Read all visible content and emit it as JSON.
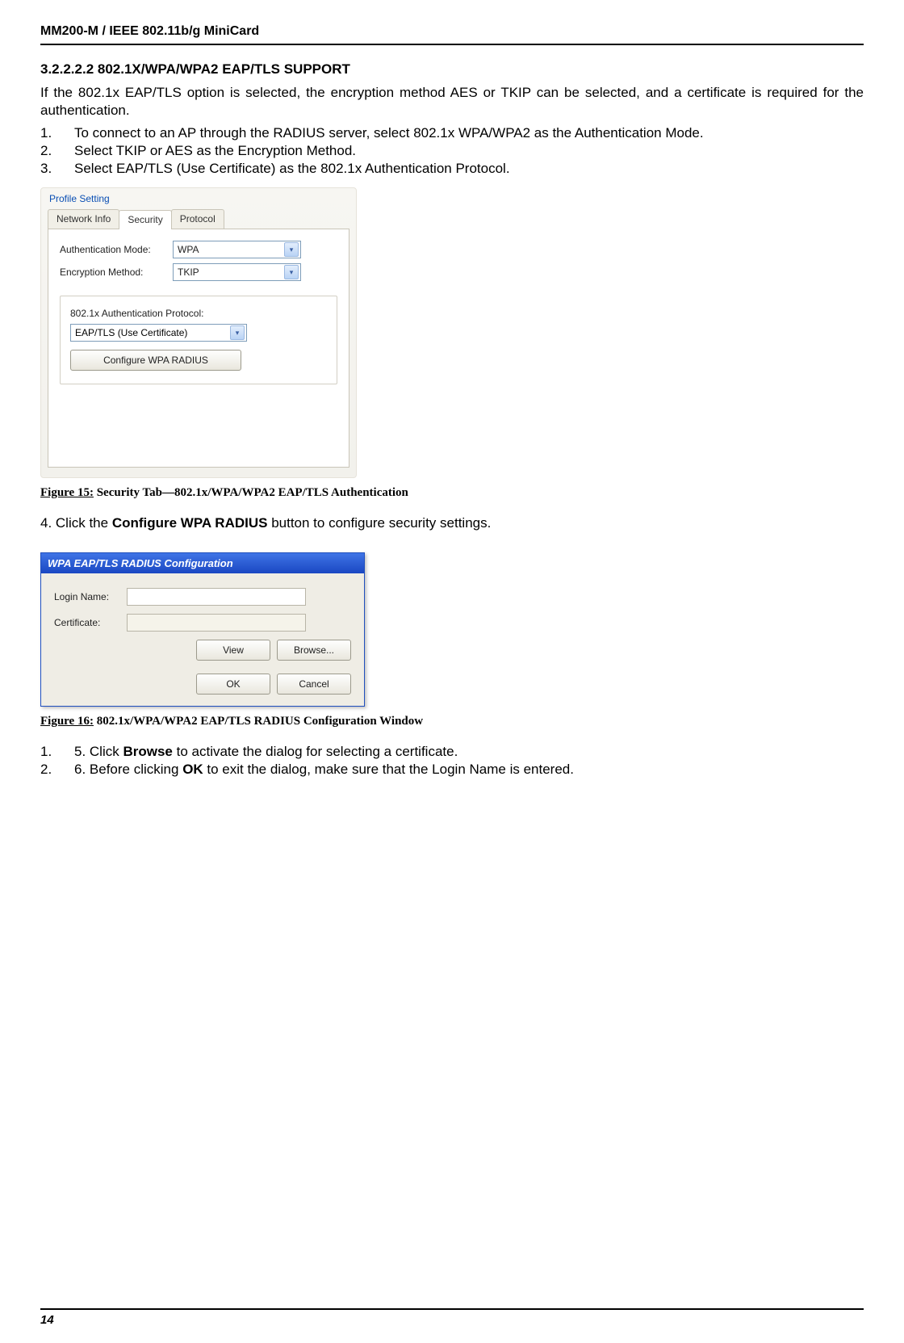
{
  "header": {
    "product": "MM200-M / IEEE 802.11b/g MiniCard"
  },
  "section": {
    "heading": "3.2.2.2.2 802.1X/WPA/WPA2 EAP/TLS SUPPORT"
  },
  "intro": "If the 802.1x EAP/TLS option is selected, the encryption method AES or TKIP can be selected, and a certificate is required for the authentication.",
  "steps1": [
    "To connect to an AP through the RADIUS server, select 802.1x WPA/WPA2 as the Authentication Mode.",
    "Select TKIP or AES as the Encryption Method.",
    "Select EAP/TLS (Use Certificate) as the 802.1x Authentication Protocol."
  ],
  "profile_panel": {
    "title": "Profile Setting",
    "tabs": [
      "Network Info",
      "Security",
      "Protocol"
    ],
    "active_tab_index": 1,
    "auth_mode_label": "Authentication Mode:",
    "auth_mode_value": "WPA",
    "enc_method_label": "Encryption Method:",
    "enc_method_value": "TKIP",
    "group_label": "802.1x Authentication Protocol:",
    "protocol_value": "EAP/TLS (Use Certificate)",
    "configure_btn": "Configure WPA RADIUS"
  },
  "figure15": {
    "label": "Figure 15:",
    "caption": " Security Tab—802.1x/WPA/WPA2 EAP/TLS Authentication"
  },
  "step4_prefix": "4. Click the ",
  "step4_bold": "Configure WPA RADIUS",
  "step4_suffix": " button to configure security settings.",
  "radius_window": {
    "title": "WPA EAP/TLS RADIUS Configuration",
    "login_label": "Login Name:",
    "cert_label": "Certificate:",
    "view_btn": "View",
    "browse_btn": "Browse...",
    "ok_btn": "OK",
    "cancel_btn": "Cancel"
  },
  "figure16": {
    "label": "Figure 16:",
    "caption": " 802.1x/WPA/WPA2 EAP/TLS RADIUS Configuration Window"
  },
  "steps2": [
    {
      "num": "1.",
      "prefix": "5. Click ",
      "bold": "Browse",
      "suffix": " to activate the dialog for selecting a certificate."
    },
    {
      "num": "2.",
      "prefix": "6. Before clicking ",
      "bold": "OK",
      "suffix": " to exit the dialog, make sure that the Login Name is entered."
    }
  ],
  "footer": {
    "page": "14"
  }
}
